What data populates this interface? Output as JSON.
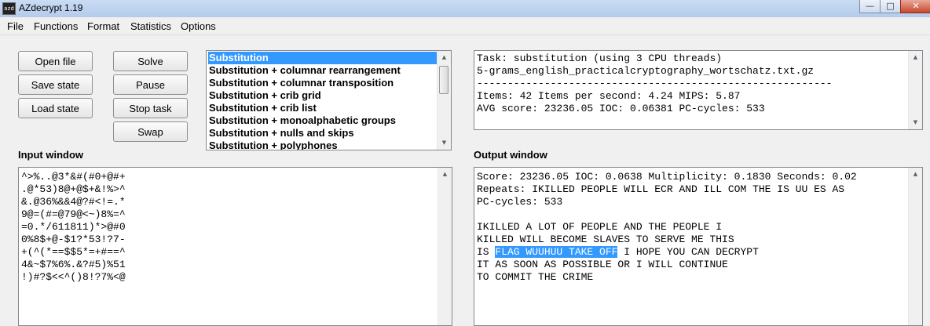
{
  "window": {
    "title": "AZdecrypt 1.19",
    "icon_text": "azd",
    "minimize_glyph": "—",
    "maximize_glyph": "□",
    "close_glyph": "✕"
  },
  "menu": [
    "File",
    "Functions",
    "Format",
    "Statistics",
    "Options"
  ],
  "buttons": {
    "open_file": "Open file",
    "save_state": "Save state",
    "load_state": "Load state",
    "solve": "Solve",
    "pause": "Pause",
    "stop_task": "Stop task",
    "swap": "Swap"
  },
  "solver_list": {
    "selected": "Substitution",
    "items": [
      "Substitution",
      "Substitution + columnar rearrangement",
      "Substitution + columnar transposition",
      "Substitution + crib grid",
      "Substitution + crib list",
      "Substitution + monoalphabetic groups",
      "Substitution + nulls and skips",
      "Substitution + polyphones"
    ]
  },
  "status": {
    "lines": [
      "Task: substitution (using 3 CPU threads)",
      "5-grams_english_practicalcryptography_wortschatz.txt.gz",
      "----------------------------------------------------------",
      "Items: 42 Items per second: 4.24 MIPS: 5.87",
      "AVG score: 23236.05 IOC: 0.06381 PC-cycles: 533"
    ]
  },
  "input": {
    "label": "Input window",
    "lines": [
      "^>%..@3*&#(#0+@#+",
      ".@*53)8@+@$+&!%>^",
      "&.@36%&&4@?#<!=.*",
      "9@=(#=@79@<~)8%=^",
      "=0.*/611811)*>@#0",
      "0%8$+@-$1?*53!?7-",
      "+(^(*==$$5*=+#==^",
      "4&~$7%6%.&?#5)%51",
      "!)#?$<<^()8!?7%<@"
    ]
  },
  "output": {
    "label": "Output window",
    "lines": [
      "Score: 23236.05 IOC: 0.0638 Multiplicity: 0.1830 Seconds: 0.02",
      "Repeats: IKILLED PEOPLE WILL ECR AND ILL COM THE IS UU ES AS",
      "PC-cycles: 533",
      "",
      "IKILLED A LOT OF PEOPLE AND THE PEOPLE I",
      "KILLED WILL BECOME SLAVES TO SERVE ME THIS"
    ],
    "line7_prefix": "IS ",
    "line7_highlight": "FLAG WUUHUU TAKE OFF",
    "line7_suffix": " I HOPE YOU CAN DECRYPT",
    "lines_after": [
      "IT AS SOON AS POSSIBLE OR I WILL CONTINUE",
      "TO COMMIT THE CRIME"
    ]
  },
  "icons": {
    "up_arrow": "▲",
    "down_arrow": "▼"
  }
}
